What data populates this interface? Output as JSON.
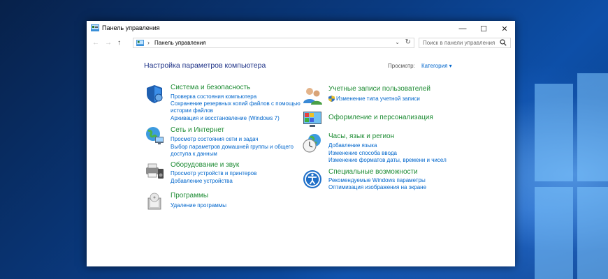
{
  "window": {
    "title": "Панель управления",
    "controls": {
      "minimize": "—",
      "maximize": "☐",
      "close": "✕"
    }
  },
  "address_bar": {
    "back": "←",
    "forward": "→",
    "up": "↑",
    "separator": "›",
    "path": "Панель управления",
    "dropdown": "⌄",
    "refresh": "↻"
  },
  "search": {
    "placeholder": "Поиск в панели управления"
  },
  "main": {
    "heading": "Настройка параметров компьютера",
    "view_label": "Просмотр:",
    "view_value": "Категория ▾"
  },
  "categories": [
    {
      "title": "Система и безопасность",
      "links": [
        "Проверка состояния компьютера",
        "Сохранение резервных копий файлов с помощью",
        "истории файлов",
        "Архивация и восстановление (Windows 7)"
      ]
    },
    {
      "title": "Сеть и Интернет",
      "links": [
        "Просмотр состояния сети и задач",
        "Выбор параметров домашней группы и общего",
        "доступа к данным"
      ]
    },
    {
      "title": "Оборудование и звук",
      "links": [
        "Просмотр устройств и принтеров",
        "Добавление устройства"
      ]
    },
    {
      "title": "Программы",
      "links": [
        "Удаление программы"
      ]
    },
    {
      "title": "Учетные записи пользователей",
      "links": [
        "Изменение типа учетной записи"
      ]
    },
    {
      "title": "Оформление и персонализация",
      "links": []
    },
    {
      "title": "Часы, язык и регион",
      "links": [
        "Добавление языка",
        "Изменение способа ввода",
        "Изменение форматов даты, времени и чисел"
      ]
    },
    {
      "title": "Специальные возможности",
      "links": [
        "Рекомендуемые Windows параметры",
        "Оптимизация изображения на экране"
      ]
    }
  ],
  "colors": {
    "accent_green": "#1e8c34",
    "link_blue": "#0066cc",
    "heading_blue": "#1e3287"
  }
}
